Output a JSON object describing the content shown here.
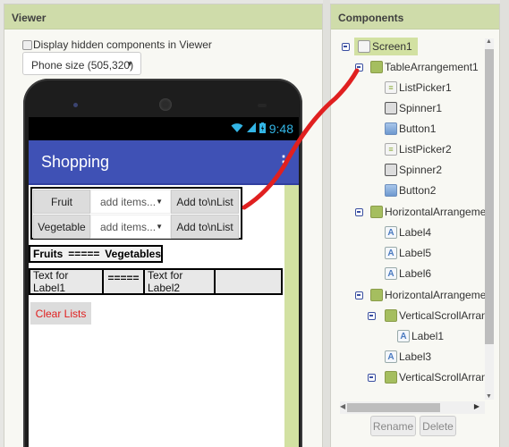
{
  "viewer": {
    "title": "Viewer",
    "hidden_components_label": "Display hidden components in Viewer",
    "hidden_components_checked": false,
    "phone_size": "Phone size (505,320)"
  },
  "phone": {
    "status": {
      "time": "9:48",
      "icons": [
        "wifi-icon",
        "signal-icon",
        "battery-charging-icon"
      ]
    },
    "app_title": "Shopping",
    "overflow_menu": "⋮",
    "table_arrangement": {
      "rows": [
        {
          "listpicker": "Fruit",
          "spinner": "add items...",
          "button": "Add to\\nList"
        },
        {
          "listpicker": "Vegetable",
          "spinner": "add items...",
          "button": "Add to\\nList"
        }
      ]
    },
    "header_labels": {
      "label4": "Fruits",
      "label5": "=====",
      "label6": "Vegetables"
    },
    "lists": {
      "label1": "Text for Label1",
      "label3": "=====",
      "label2": "Text for Label2",
      "empty": ""
    },
    "clear_button": "Clear Lists"
  },
  "components": {
    "title": "Components",
    "tree": [
      {
        "name": "Screen1",
        "icon": "screen-icon",
        "level": 0,
        "collapsible": true,
        "selected": true
      },
      {
        "name": "TableArrangement1",
        "icon": "table-arrangement-icon",
        "level": 1,
        "collapsible": true
      },
      {
        "name": "ListPicker1",
        "icon": "listpicker-icon",
        "level": 2
      },
      {
        "name": "Spinner1",
        "icon": "spinner-icon",
        "level": 2
      },
      {
        "name": "Button1",
        "icon": "button-icon",
        "level": 2
      },
      {
        "name": "ListPicker2",
        "icon": "listpicker-icon",
        "level": 2
      },
      {
        "name": "Spinner2",
        "icon": "spinner-icon",
        "level": 2
      },
      {
        "name": "Button2",
        "icon": "button-icon",
        "level": 2
      },
      {
        "name": "HorizontalArrangemen",
        "icon": "horizontal-arrangement-icon",
        "level": 1,
        "collapsible": true
      },
      {
        "name": "Label4",
        "icon": "label-icon",
        "level": 2
      },
      {
        "name": "Label5",
        "icon": "label-icon",
        "level": 2
      },
      {
        "name": "Label6",
        "icon": "label-icon",
        "level": 2
      },
      {
        "name": "HorizontalArrangemen",
        "icon": "horizontal-arrangement-icon",
        "level": 1,
        "collapsible": true
      },
      {
        "name": "VerticalScrollArrang",
        "icon": "vertical-scroll-arrangement-icon",
        "level": 2,
        "collapsible": true
      },
      {
        "name": "Label1",
        "icon": "label-icon",
        "level": 3
      },
      {
        "name": "Label3",
        "icon": "label-icon",
        "level": 2
      },
      {
        "name": "VerticalScrollArrang",
        "icon": "vertical-scroll-arrangement-icon",
        "level": 2,
        "collapsible": true
      }
    ],
    "rename_label": "Rename",
    "delete_label": "Delete"
  },
  "annotation": {
    "color": "#e02020"
  }
}
